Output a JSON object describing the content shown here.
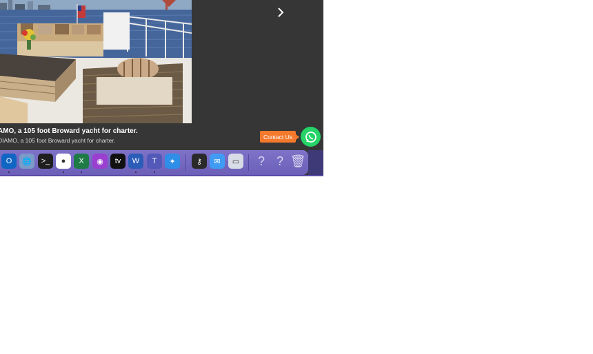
{
  "gallery": {
    "image_description_name": "yacht-deck-photo",
    "next_label": "›"
  },
  "caption": {
    "title": "AMO, a 105 foot Broward yacht for charter.",
    "subtitle": "DIAMO, a 105 foot Broward yacht for charter."
  },
  "contact": {
    "label": "Contact Us"
  },
  "dock": {
    "apps": [
      {
        "name": "outlook",
        "glyph": "O",
        "bg": "#1166c4",
        "running": true
      },
      {
        "name": "network-utility",
        "glyph": "🌐",
        "bg": "#7b9bc9",
        "running": false
      },
      {
        "name": "terminal",
        "glyph": ">_",
        "bg": "#1f1f1f",
        "running": false
      },
      {
        "name": "chrome",
        "glyph": "●",
        "bg": "#ffffff",
        "running": true
      },
      {
        "name": "excel",
        "glyph": "X",
        "bg": "#1e7b45",
        "running": true
      },
      {
        "name": "podcasts",
        "glyph": "◉",
        "bg": "#9a3fd0",
        "running": false
      },
      {
        "name": "apple-tv",
        "glyph": "tv",
        "bg": "#111111",
        "running": false
      },
      {
        "name": "word",
        "glyph": "W",
        "bg": "#2b5cb8",
        "running": true
      },
      {
        "name": "teams",
        "glyph": "T",
        "bg": "#5259b8",
        "running": true
      },
      {
        "name": "safari",
        "glyph": "✦",
        "bg": "#2f8ee8",
        "running": false
      },
      {
        "name": "keychain",
        "glyph": "⚷",
        "bg": "#2a2a2a",
        "running": false
      },
      {
        "name": "mail",
        "glyph": "✉",
        "bg": "#3f9bf3",
        "running": false
      },
      {
        "name": "preview",
        "glyph": "▭",
        "bg": "#d8dce6",
        "running": false
      },
      {
        "name": "unknown-app-1",
        "glyph": "?",
        "bg": "transparent",
        "running": false
      },
      {
        "name": "unknown-app-2",
        "glyph": "?",
        "bg": "transparent",
        "running": false
      },
      {
        "name": "trash",
        "glyph": "🗑",
        "bg": "transparent",
        "running": false
      }
    ]
  }
}
